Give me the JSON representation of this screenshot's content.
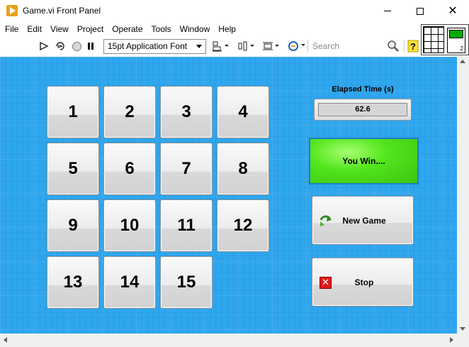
{
  "window": {
    "title": "Game.vi Front Panel",
    "minimize_glyph": "",
    "maximize_glyph": "",
    "close_glyph": "✕"
  },
  "menu": [
    "File",
    "Edit",
    "View",
    "Project",
    "Operate",
    "Tools",
    "Window",
    "Help"
  ],
  "toolbar": {
    "font": "15pt Application Font",
    "search_placeholder": "Search",
    "icons": [
      "run-arrow-icon",
      "run-continuously-icon",
      "abort-icon",
      "pause-icon",
      "align-icon",
      "distribute-icon",
      "resize-icon",
      "reorder-icon",
      "search-icon",
      "help-icon"
    ]
  },
  "connector_pane": {
    "icon_number": "2"
  },
  "board": {
    "tiles": [
      "1",
      "2",
      "3",
      "4",
      "5",
      "6",
      "7",
      "8",
      "9",
      "10",
      "11",
      "12",
      "13",
      "14",
      "15"
    ]
  },
  "status": {
    "elapsed_label": "Elapsed Time (s)",
    "elapsed_value": "62.6",
    "win_text": "You Win....",
    "win_color": "#52e61c"
  },
  "buttons": {
    "new_game": "New Game",
    "stop": "Stop",
    "stop_glyph": "✕"
  },
  "colors": {
    "panel_background": "#2fa7ef"
  }
}
